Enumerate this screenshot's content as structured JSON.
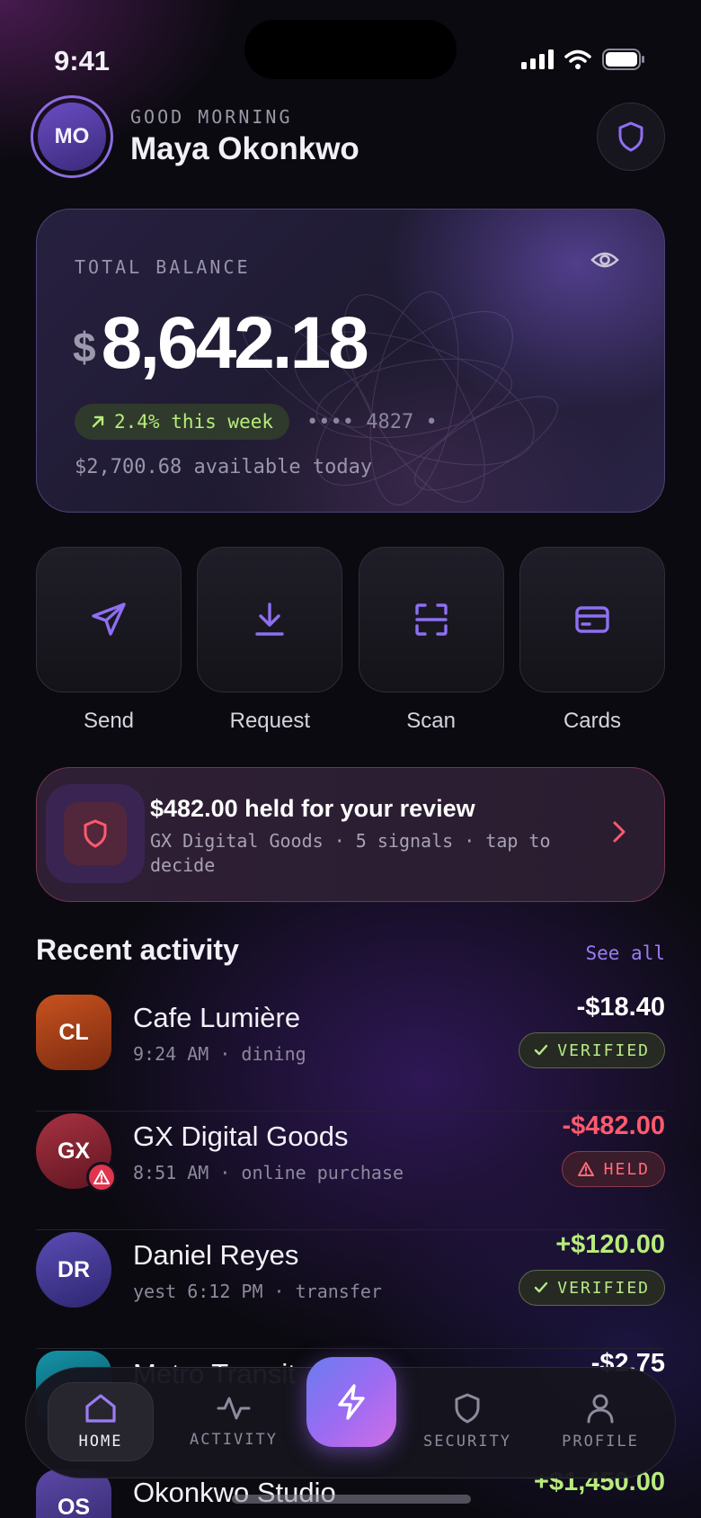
{
  "status": {
    "time": "9:41"
  },
  "header": {
    "initials": "MO",
    "greeting": "GOOD MORNING",
    "name": "Maya Okonkwo"
  },
  "balance_card": {
    "label": "TOTAL BALANCE",
    "currency": "$",
    "amount": "8,642.18",
    "change": "2.4% this week",
    "card_masked": "•••• 4827 •",
    "available": "$2,700.68 available today"
  },
  "actions": [
    {
      "label": "Send",
      "icon": "send-icon"
    },
    {
      "label": "Request",
      "icon": "download-icon"
    },
    {
      "label": "Scan",
      "icon": "scan-icon"
    },
    {
      "label": "Cards",
      "icon": "card-icon"
    }
  ],
  "alert": {
    "title": "$482.00 held for your review",
    "subtitle": "GX Digital Goods · 5 signals · tap to decide"
  },
  "activity": {
    "title": "Recent activity",
    "see_all": "See all",
    "items": [
      {
        "initials": "CL",
        "name": "Cafe Lumière",
        "meta": "9:24 AM · dining",
        "amount": "-$18.40",
        "badge": "VERIFIED",
        "status": "verified",
        "color": "#b8471c"
      },
      {
        "initials": "GX",
        "name": "GX Digital Goods",
        "meta": "8:51 AM · online purchase",
        "amount": "-$482.00",
        "badge": "HELD",
        "status": "held",
        "color": "#8c2535"
      },
      {
        "initials": "DR",
        "name": "Daniel Reyes",
        "meta": "yest 6:12 PM · transfer",
        "amount": "+$120.00",
        "badge": "VERIFIED",
        "status": "verified",
        "color": "#4a3f9c"
      },
      {
        "initials": "",
        "name": "Metro Transit",
        "meta": "",
        "amount": "-$2.75",
        "badge": "",
        "status": "",
        "color": "#0e6f86"
      },
      {
        "initials": "OS",
        "name": "Okonkwo Studio",
        "meta": "",
        "amount": "+$1,450.00",
        "badge": "",
        "status": "",
        "color": "#4b3a8a"
      }
    ]
  },
  "tabs": [
    {
      "label": "HOME",
      "icon": "home-icon",
      "active": true
    },
    {
      "label": "ACTIVITY",
      "icon": "pulse-icon",
      "active": false
    },
    {
      "label": "SECURITY",
      "icon": "shield-icon",
      "active": false
    },
    {
      "label": "PROFILE",
      "icon": "user-icon",
      "active": false
    }
  ],
  "colors": {
    "accent": "#8b6cf0",
    "positive": "#b7ec7a",
    "negative": "#ff5a6e",
    "background": "#0b0a10"
  }
}
